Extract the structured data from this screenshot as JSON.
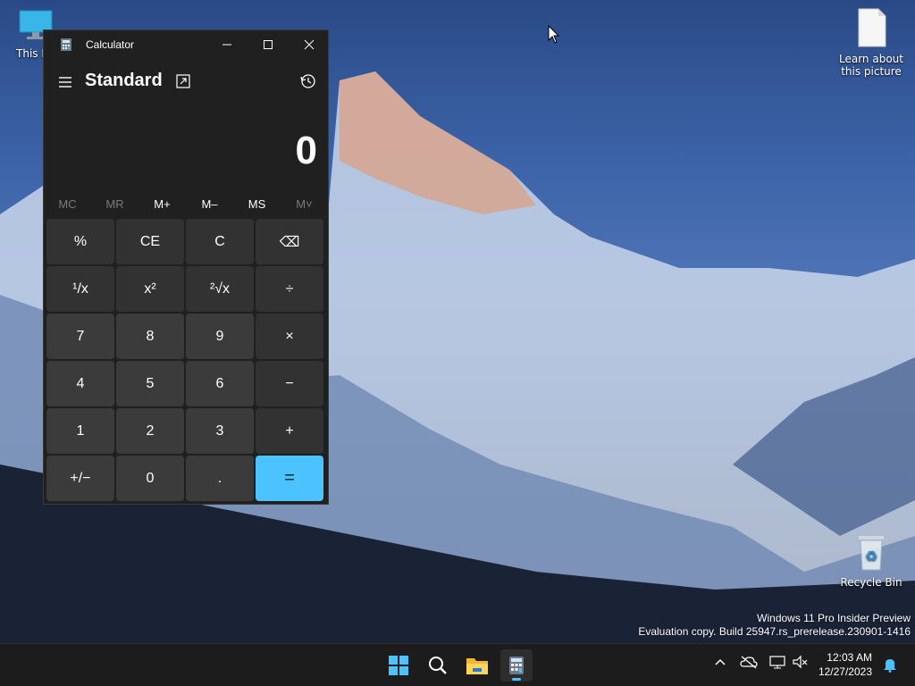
{
  "desktop": {
    "icons": [
      {
        "label": "This PC",
        "icon": "monitor-icon"
      },
      {
        "label": "Learn about this picture",
        "icon": "document-icon"
      },
      {
        "label": "Recycle Bin",
        "icon": "recycle-bin-icon"
      }
    ],
    "watermark": {
      "line1": "Windows 11 Pro Insider Preview",
      "line2": "Evaluation copy. Build 25947.rs_prerelease.230901-1416"
    }
  },
  "calculator": {
    "title": "Calculator",
    "mode": "Standard",
    "display": "0",
    "memory": [
      "MC",
      "MR",
      "M+",
      "M–",
      "MS",
      "M˅"
    ],
    "keys": [
      "%",
      "CE",
      "C",
      "⌫",
      "¹/x",
      "x²",
      "²√x",
      "÷",
      "7",
      "8",
      "9",
      "×",
      "4",
      "5",
      "6",
      "−",
      "1",
      "2",
      "3",
      "+",
      "+/−",
      "0",
      ".",
      "="
    ],
    "accent": "#4cc2ff"
  },
  "taskbar": {
    "time": "12:03 AM",
    "date": "12/27/2023",
    "apps": [
      "start-icon",
      "search-icon",
      "file-explorer-icon",
      "calculator-icon"
    ],
    "tray": [
      "chevron-up-icon",
      "onedrive-icon",
      "network-icon",
      "volume-muted-icon",
      "notification-bell-icon"
    ]
  }
}
